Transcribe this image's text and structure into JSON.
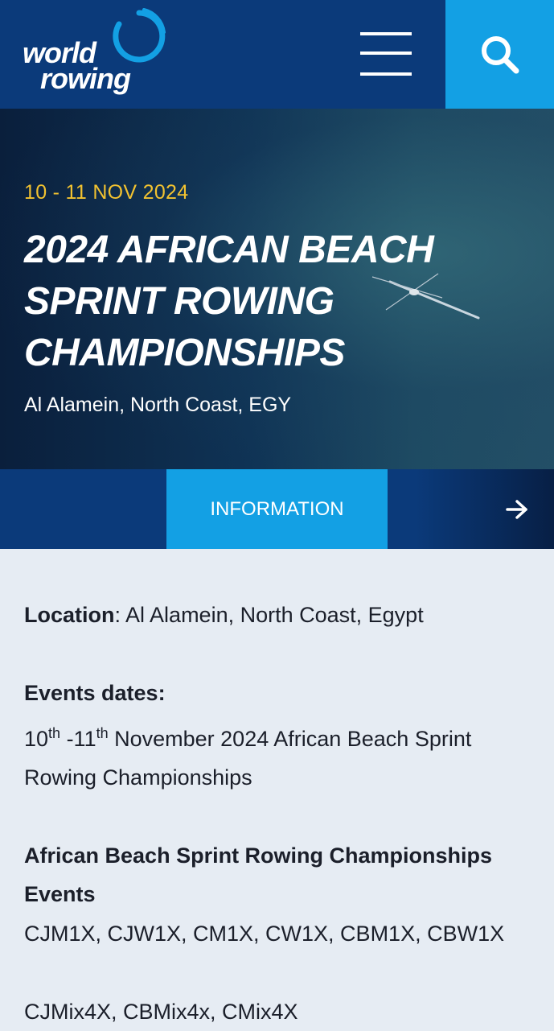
{
  "header": {
    "logo": {
      "line1": "world",
      "line2": "rowing"
    },
    "menu_icon": "hamburger-menu-icon",
    "search_icon": "search-icon",
    "colors": {
      "navy": "#0b3a7a",
      "accent": "#13a0e4"
    }
  },
  "hero": {
    "date": "10 - 11 NOV 2024",
    "title": "2024 AFRICAN BEACH SPRINT ROWING CHAMPIONSHIPS",
    "location": "Al Alamein, North Coast, EGY",
    "date_color": "#f2c230"
  },
  "tabs": {
    "active_label": "INFORMATION",
    "next_icon": "arrow-right-icon"
  },
  "content": {
    "location_label": "Location",
    "location_sep": ":",
    "location_value": " Al Alamein, North Coast, Egypt",
    "dates_heading": "Events dates:",
    "dates_day1": "10",
    "dates_sup1": "th",
    "dates_dash": " -11",
    "dates_sup2": "th",
    "dates_rest": " November 2024 African Beach Sprint Rowing Championships",
    "events_heading": "African Beach Sprint Rowing Championships Events",
    "events_singles": "CJM1X, CJW1X, CM1X, CW1X, CBM1X, CBW1X",
    "events_quads": "CJMix4X, CBMix4x, CMix4X"
  }
}
